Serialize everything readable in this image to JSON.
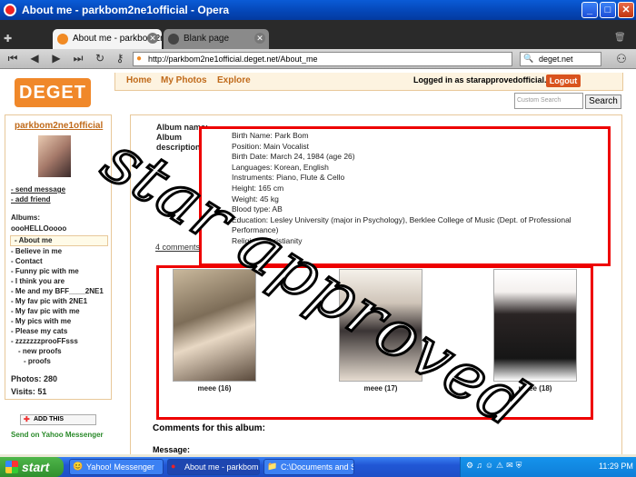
{
  "window": {
    "title": "About me - parkbom2ne1official - Opera"
  },
  "tabs": [
    {
      "label": "About me - parkbom2ne1o...",
      "active": true
    },
    {
      "label": "Blank page",
      "active": false
    }
  ],
  "address": {
    "url": "http://parkbom2ne1official.deget.net/About_me",
    "search_value": "deget.net"
  },
  "site": {
    "logo": "DEGET",
    "nav": [
      "Home",
      "My Photos",
      "Explore"
    ],
    "logged_in": "Logged in as starapprovedofficial.",
    "logout": "Logout",
    "search_placeholder": "Custom Search",
    "search_button": "Search"
  },
  "sidebar": {
    "username": "parkbom2ne1official",
    "links": [
      "- send message",
      "- add friend"
    ],
    "albums_header": "Albums:",
    "albums": [
      "oooHELLOoooo",
      "- About me",
      "- Believe in me",
      "- Contact",
      "- Funny pic with me",
      "- I think you are",
      "- Me and my BFF____2NE1",
      "- My fav pic with 2NE1",
      "- My fav pic with me",
      "- My pics with me",
      "- Please my cats",
      "- zzzzzzzprooFFsss",
      "- new proofs",
      "- proofs"
    ],
    "photos": "Photos: 280",
    "visits": "Visits: 51",
    "addthis": "ADD THIS",
    "yahoo": "Send on Yahoo Messenger"
  },
  "content": {
    "labels": [
      "Album name:",
      "Album",
      "description:"
    ],
    "about": [
      "Birth Name: Park Bom",
      "Position: Main Vocalist",
      "Birth Date: March 24, 1984 (age 26)",
      "Languages: Korean, English",
      "Instruments: Piano, Flute & Cello",
      "Height: 165 cm",
      "Weight: 45 kg",
      "Blood type: AB",
      "Education: Lesley University (major in Psychology), Berklee College of Music (Dept. of Professional Performance)",
      "Religion: Christianity"
    ],
    "comments_link": "4 comments",
    "photos": [
      "meee (16)",
      "meee (17)",
      "meee (18)"
    ],
    "comments_title": "Comments for this album:",
    "message_label": "Message:"
  },
  "watermark": "star approved",
  "taskbar": {
    "start": "start",
    "items": [
      "Yahoo! Messenger",
      "About me - parkbom...",
      "C:\\Documents and S..."
    ],
    "clock": "11:29 PM"
  }
}
